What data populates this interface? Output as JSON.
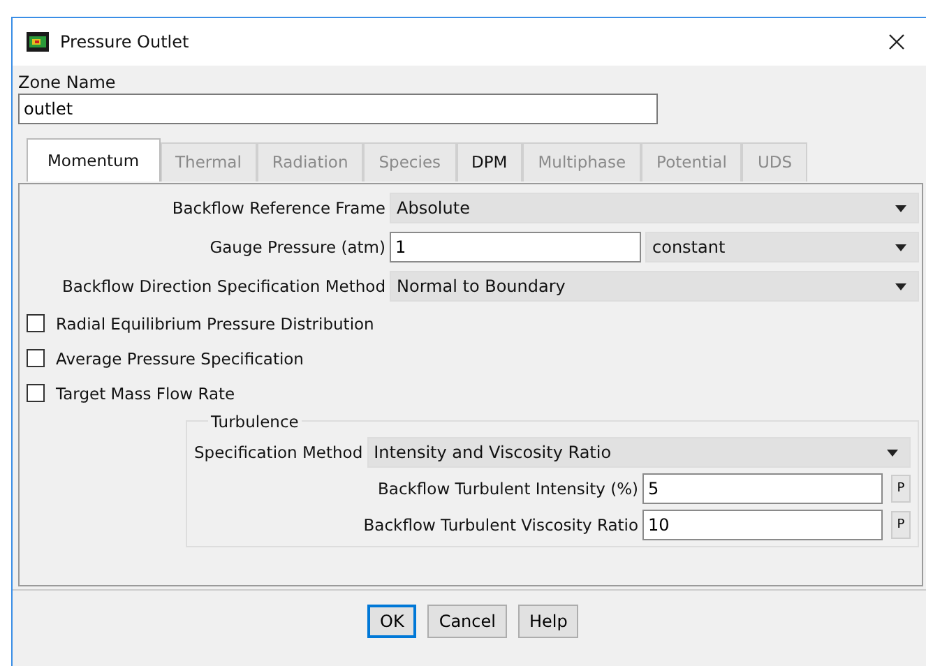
{
  "window": {
    "title": "Pressure Outlet"
  },
  "zone": {
    "label": "Zone Name",
    "value": "outlet"
  },
  "tabs": [
    {
      "label": "Momentum",
      "selected": true,
      "disabled": false
    },
    {
      "label": "Thermal",
      "selected": false,
      "disabled": true
    },
    {
      "label": "Radiation",
      "selected": false,
      "disabled": true
    },
    {
      "label": "Species",
      "selected": false,
      "disabled": true
    },
    {
      "label": "DPM",
      "selected": false,
      "disabled": false
    },
    {
      "label": "Multiphase",
      "selected": false,
      "disabled": true
    },
    {
      "label": "Potential",
      "selected": false,
      "disabled": true
    },
    {
      "label": "UDS",
      "selected": false,
      "disabled": true
    }
  ],
  "fields": [
    {
      "kind": "dropdown",
      "label": "Backflow Reference Frame",
      "value": "Absolute"
    },
    {
      "kind": "input-dropdown",
      "label": "Gauge Pressure (atm)",
      "value": "1",
      "option": "constant"
    },
    {
      "kind": "dropdown",
      "label": "Backflow Direction Specification Method",
      "value": "Normal to Boundary"
    }
  ],
  "checkboxes": [
    {
      "label": "Radial Equilibrium Pressure Distribution",
      "checked": false
    },
    {
      "label": "Average Pressure Specification",
      "checked": false
    },
    {
      "label": "Target Mass Flow Rate",
      "checked": false
    }
  ],
  "turbulence": {
    "title": "Turbulence",
    "method_label": "Specification Method",
    "method": "Intensity and Viscosity Ratio",
    "params": [
      {
        "label": "Backflow Turbulent Intensity (%)",
        "value": "5",
        "button": "P"
      },
      {
        "label": "Backflow Turbulent Viscosity Ratio",
        "value": "10",
        "button": "P"
      }
    ]
  },
  "buttons": [
    {
      "label": "OK",
      "selected": true
    },
    {
      "label": "Cancel",
      "selected": false
    },
    {
      "label": "Help",
      "selected": false
    }
  ]
}
